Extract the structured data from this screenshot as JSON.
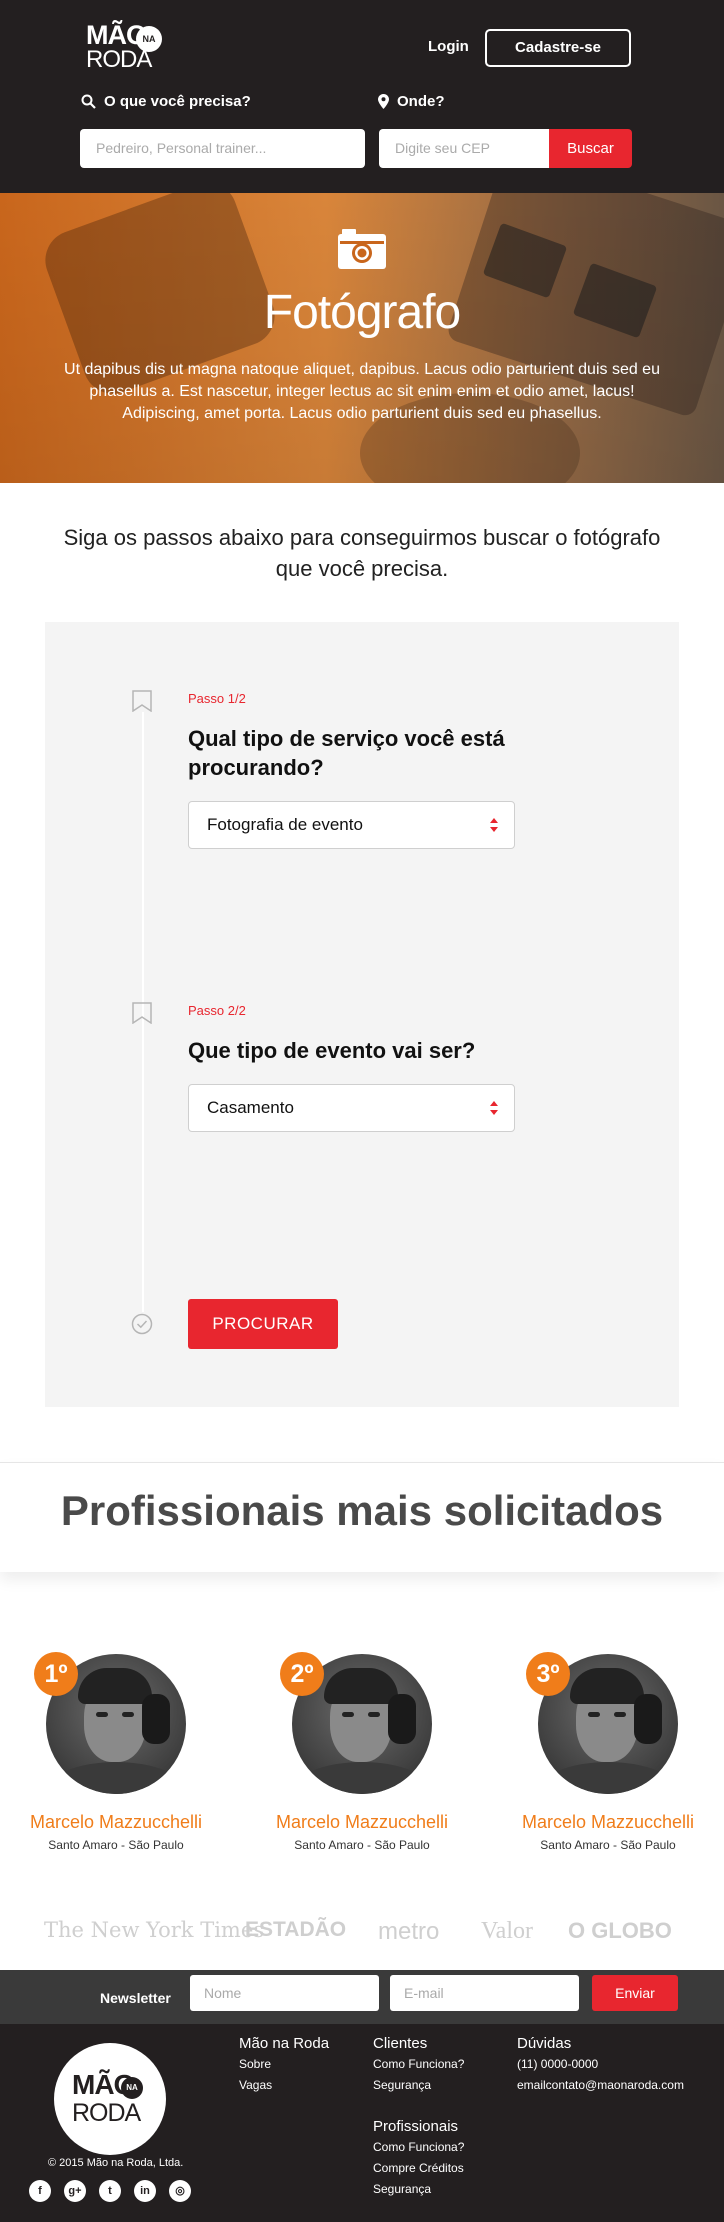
{
  "header": {
    "logo": {
      "mao": "MÃO",
      "na": "NA",
      "roda": "RODA"
    },
    "login": "Login",
    "signup": "Cadastre-se",
    "what_label": "O que você precisa?",
    "where_label": "Onde?",
    "what_placeholder": "Pedreiro, Personal trainer...",
    "cep_placeholder": "Digite seu CEP",
    "search_button": "Buscar"
  },
  "hero": {
    "title": "Fotógrafo",
    "description": "Ut dapibus dis ut magna natoque aliquet, dapibus. Lacus odio parturient duis sed eu phasellus a. Est nascetur, integer lectus ac sit enim enim et odio amet, lacus! Adipiscing, amet porta. Lacus odio parturient duis sed eu phasellus."
  },
  "steps": {
    "intro": "Siga os passos abaixo para conseguirmos buscar o fotógrafo que você precisa.",
    "step1": {
      "label": "Passo 1/2",
      "question": "Qual tipo de serviço você está procurando?",
      "selected": "Fotografia de evento"
    },
    "step2": {
      "label": "Passo 2/2",
      "question": "Que tipo de evento vai ser?",
      "selected": "Casamento"
    },
    "submit": "PROCURAR"
  },
  "professionals": {
    "title": "Profissionais mais solicitados",
    "items": [
      {
        "rank": "1º",
        "name": "Marcelo Mazzucchelli",
        "location": "Santo Amaro - São Paulo"
      },
      {
        "rank": "2º",
        "name": "Marcelo Mazzucchelli",
        "location": "Santo Amaro - São Paulo"
      },
      {
        "rank": "3º",
        "name": "Marcelo Mazzucchelli",
        "location": "Santo Amaro - São Paulo"
      }
    ]
  },
  "press": [
    "The New York Times",
    "ESTADÃO",
    "metro",
    "Valor",
    "O GLOBO"
  ],
  "newsletter": {
    "label": "Newsletter",
    "name_placeholder": "Nome",
    "email_placeholder": "E-mail",
    "button": "Enviar"
  },
  "footer": {
    "logo": {
      "mao": "MÃO",
      "na": "NA",
      "roda": "RODA"
    },
    "copyright": "© 2015 Mão na Roda, Ltda.",
    "col1": {
      "title": "Mão na Roda",
      "links": [
        "Sobre",
        "Vagas"
      ]
    },
    "col2": {
      "title": "Clientes",
      "links": [
        "Como Funciona?",
        "Segurança"
      ]
    },
    "col3": {
      "title": "Dúvidas",
      "links": [
        "(11) 0000-0000",
        "emailcontato@maonaroda.com"
      ]
    },
    "col4": {
      "title": "Profissionais",
      "links": [
        "Como Funciona?",
        "Compre Créditos",
        "Segurança"
      ]
    },
    "social_icons": [
      "facebook-icon",
      "google-plus-icon",
      "twitter-icon",
      "linkedin-icon",
      "instagram-icon"
    ]
  },
  "colors": {
    "accent": "#e8262f",
    "orange": "#f07d1a",
    "dark": "#231f20"
  }
}
